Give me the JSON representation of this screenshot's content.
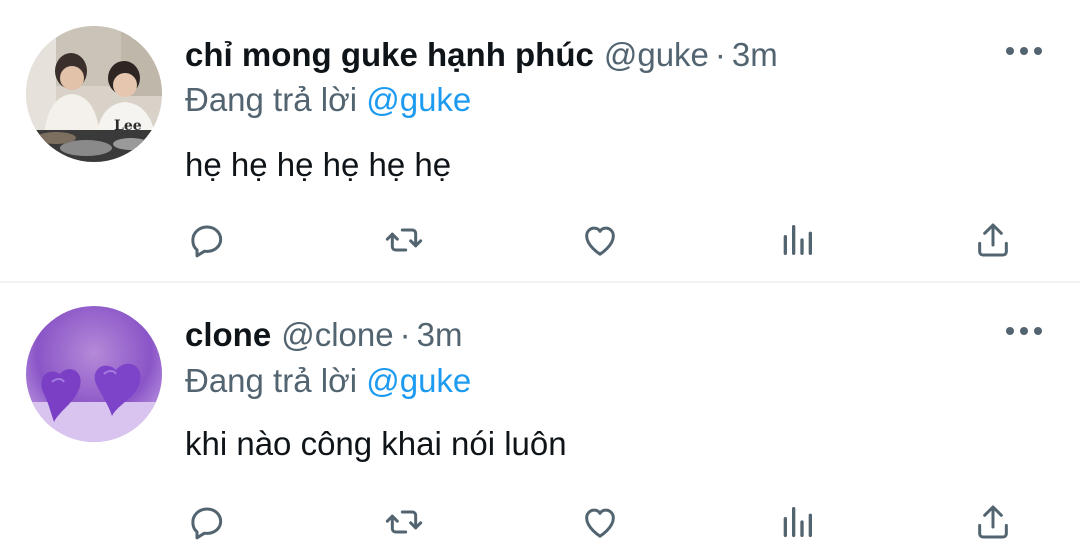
{
  "tweets": [
    {
      "display_name": "chỉ mong guke hạnh phúc",
      "handle": "@guke",
      "separator": "·",
      "time": "3m",
      "reply_prefix": "Đang trả lời",
      "reply_to": "@guke",
      "text": "hẹ hẹ hẹ hẹ hẹ hẹ",
      "avatar": "photo-two-people-at-table"
    },
    {
      "display_name": "clone",
      "handle": "@clone",
      "separator": "·",
      "time": "3m",
      "reply_prefix": "Đang trả lời",
      "reply_to": "@guke",
      "text": "khi nào công khai nói luôn",
      "avatar": "purple-hearts"
    }
  ],
  "actions": [
    "reply-icon",
    "retweet-icon",
    "like-icon",
    "views-icon",
    "share-icon"
  ],
  "colors": {
    "text": "#0f1419",
    "secondary": "#536471",
    "link": "#1d9bf0",
    "divider": "#eff3f4"
  }
}
